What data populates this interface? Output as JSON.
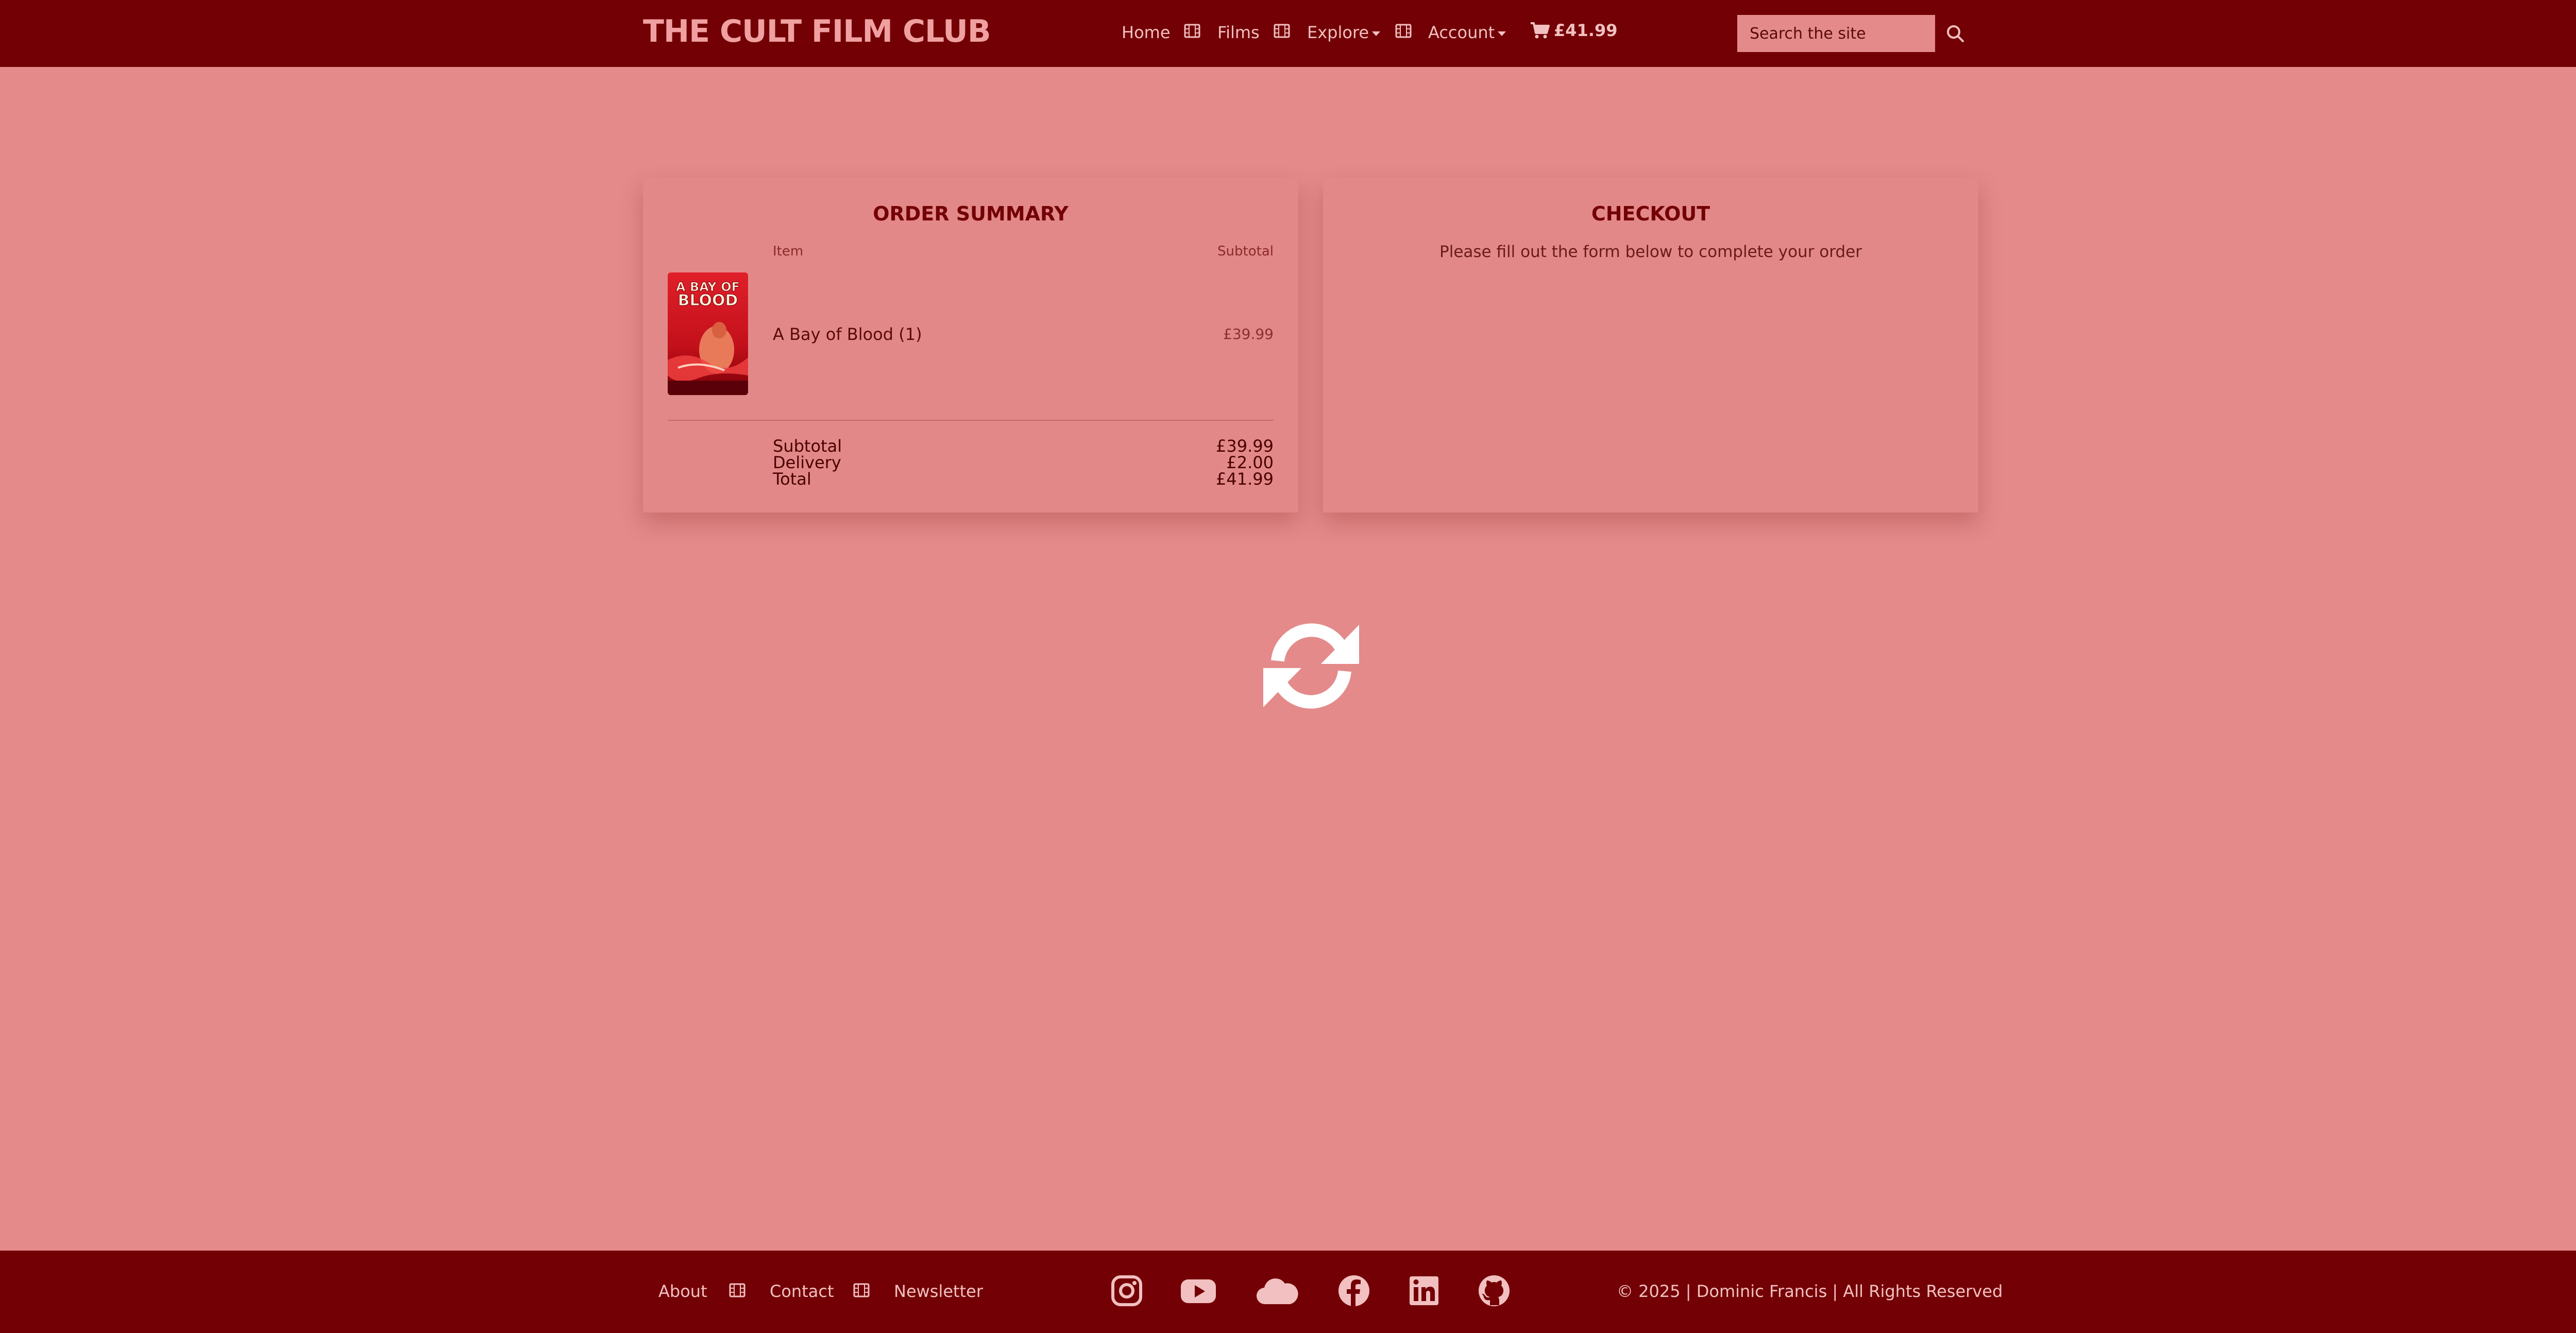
{
  "header": {
    "brand": "THE CULT FILM CLUB",
    "nav": {
      "home": "Home",
      "films": "Films",
      "explore": "Explore",
      "account": "Account",
      "cart_total": "£41.99"
    },
    "search": {
      "placeholder": "Search the site"
    }
  },
  "order_summary": {
    "title": "ORDER SUMMARY",
    "columns": {
      "item": "Item",
      "subtotal": "Subtotal"
    },
    "items": [
      {
        "name": "A Bay of Blood (1)",
        "price": "£39.99",
        "poster_text": [
          "A BAY OF",
          "BLOOD"
        ]
      }
    ],
    "totals": {
      "subtotal_label": "Subtotal",
      "subtotal_value": "£39.99",
      "delivery_label": "Delivery",
      "delivery_value": "£2.00",
      "total_label": "Total",
      "total_value": "£41.99"
    }
  },
  "checkout": {
    "title": "CHECKOUT",
    "subtitle": "Please fill out the form below to complete your order"
  },
  "footer": {
    "links": {
      "about": "About",
      "contact": "Contact",
      "newsletter": "Newsletter"
    },
    "social_icons": [
      "instagram-icon",
      "youtube-icon",
      "cloud-icon",
      "facebook-icon",
      "linkedin-icon",
      "github-icon"
    ],
    "copyright": "© 2025 | Dominic Francis | All Rights Reserved"
  },
  "colors": {
    "navbar": "#730005",
    "page_background": "#e48a8a",
    "brand_text": "#f0a0a0",
    "title_text": "#730005"
  }
}
